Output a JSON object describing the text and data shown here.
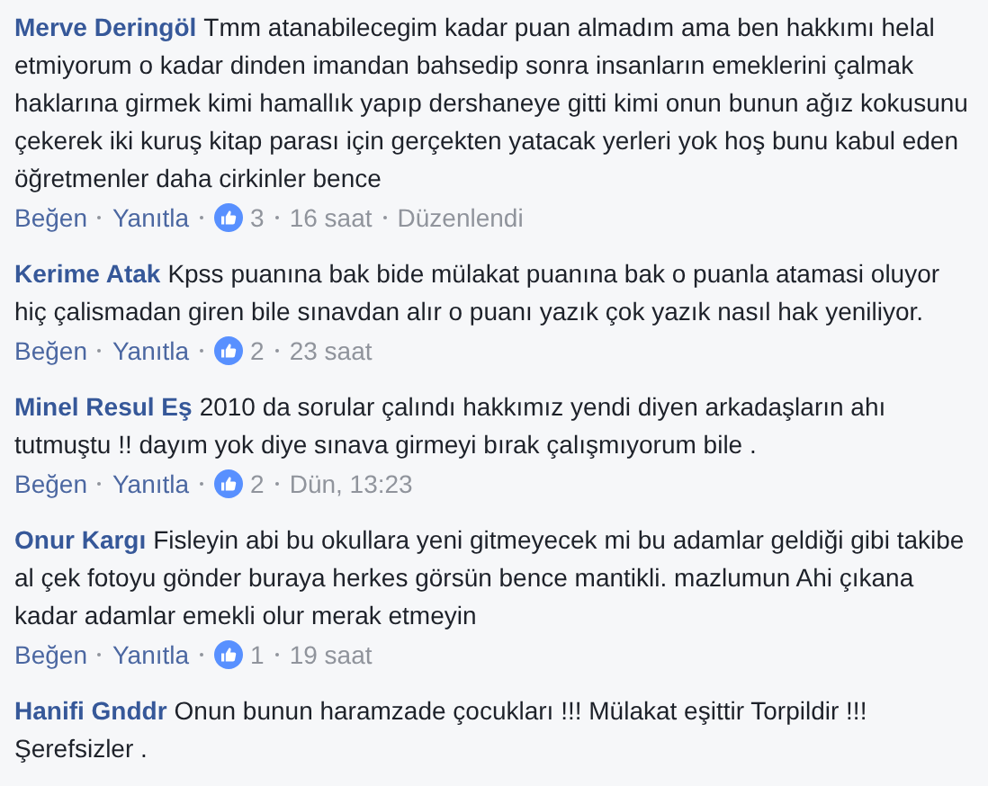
{
  "comments": [
    {
      "author": "Merve Deringöl",
      "text": "Tmm atanabilecegim kadar puan almadım ama ben hakkımı helal etmiyorum o kadar dinden imandan bahsedip sonra insanların emeklerini çalmak haklarına girmek kimi hamallık yapıp dershaneye gitti kimi onun bunun ağız kokusunu çekerek iki kuruş kitap parası için gerçekten yatacak yerleri yok hoş bunu kabul eden öğretmenler daha cirkinler bence",
      "like": "Beğen",
      "reply": "Yanıtla",
      "likes": "3",
      "time": "16 saat",
      "edited": "Düzenlendi"
    },
    {
      "author": "Kerime Atak",
      "text": "Kpss puanına bak bide mülakat puanına bak o puanla atamasi oluyor hiç çalismadan giren bile sınavdan alır o puanı yazık çok yazık nasıl hak yeniliyor.",
      "like": "Beğen",
      "reply": "Yanıtla",
      "likes": "2",
      "time": "23 saat"
    },
    {
      "author": "Minel Resul Eş",
      "text": "2010 da sorular çalındı hakkımız yendi diyen arkadaşların ahı tutmuştu !! dayım yok diye sınava girmeyi bırak çalışmıyorum bile .",
      "like": "Beğen",
      "reply": "Yanıtla",
      "likes": "2",
      "time": "Dün, 13:23"
    },
    {
      "author": "Onur Kargı",
      "text": "Fisleyin abi bu okullara yeni gitmeyecek mi bu adamlar geldiği gibi takibe al çek fotoyu gönder buraya herkes görsün bence mantikli. mazlumun Ahi çıkana kadar adamlar emekli olur merak etmeyin",
      "like": "Beğen",
      "reply": "Yanıtla",
      "likes": "1",
      "time": "19 saat"
    },
    {
      "author": "Hanifi Gnddr",
      "text": "Onun bunun haramzade çocukları !!! Mülakat eşittir Torpildir !!! Şerefsizler ."
    }
  ]
}
